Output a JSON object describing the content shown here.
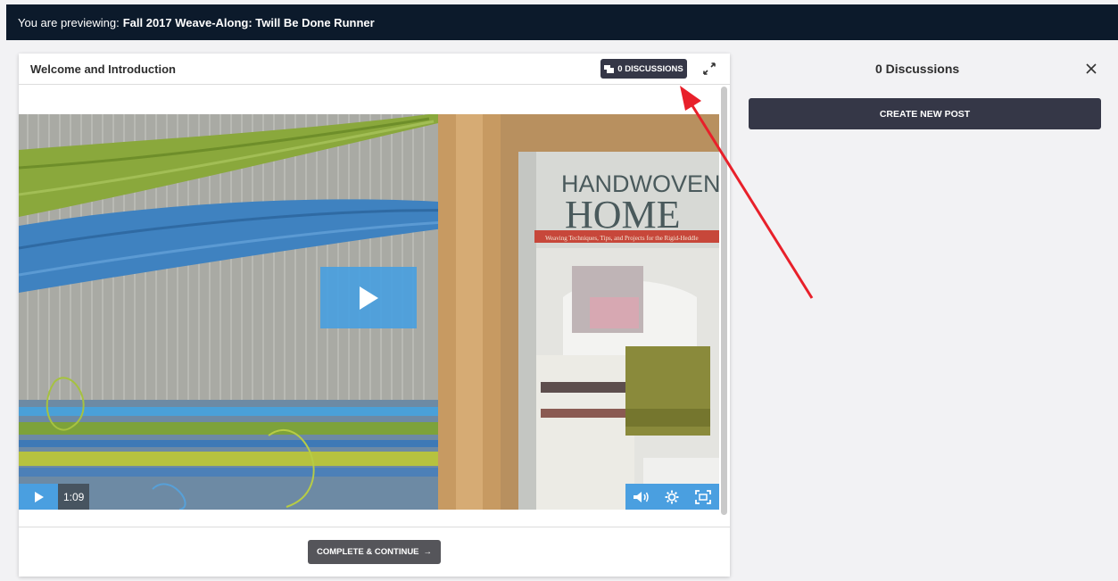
{
  "topbar": {
    "prefix": "You are previewing:",
    "course_title": "Fall 2017 Weave-Along: Twill Be Done Runner"
  },
  "lesson": {
    "title": "Welcome and Introduction",
    "discussions_button": "0 DISCUSSIONS",
    "complete_button": "COMPLETE & CONTINUE",
    "complete_arrow": "→"
  },
  "video": {
    "current_time": "1:09",
    "book_title_line1": "HANDWOVEN",
    "book_title_line2": "HOME",
    "book_subtitle": "Weaving Techniques, Tips, and Projects for the Rigid-Heddle"
  },
  "discussions_panel": {
    "title": "0 Discussions",
    "create_button": "CREATE NEW POST",
    "close_glyph": "×"
  },
  "icons": {
    "discussions": "chat-icon",
    "expand": "expand-icon",
    "close": "close-icon",
    "play": "play-icon",
    "volume": "volume-icon",
    "settings": "gear-icon",
    "fullscreen": "fullscreen-icon"
  },
  "colors": {
    "topbar_bg": "#0c1a2b",
    "button_dark": "#353747",
    "video_accent": "#4a9fe0",
    "annotation_arrow": "#e8202a"
  }
}
